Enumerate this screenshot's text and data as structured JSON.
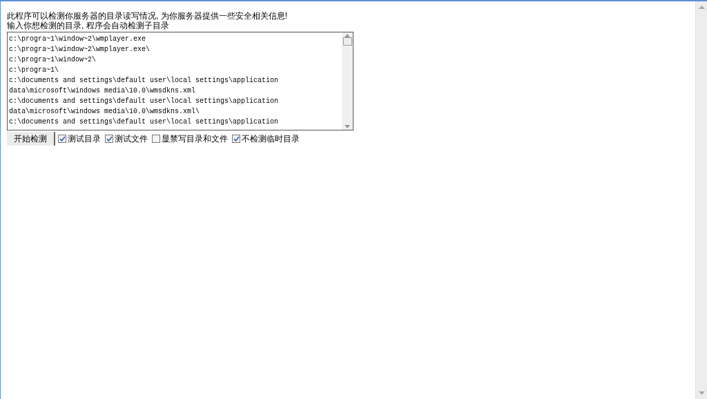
{
  "intro": [
    "此程序可以检测你服务器的目录读写情况, 为你服务器提供一些安全相关信息!",
    "输入你想检测的目录, 程序会自动检测子目录"
  ],
  "paths": [
    "c:\\progra~1\\window~2\\wmplayer.exe",
    "c:\\progra~1\\window~2\\wmplayer.exe\\",
    "c:\\progra~1\\window~2\\",
    "c:\\progra~1\\",
    "c:\\documents and settings\\default user\\local settings\\application",
    "data\\microsoft\\windows media\\10.0\\wmsdkns.xml",
    "c:\\documents and settings\\default user\\local settings\\application",
    "data\\microsoft\\windows media\\10.0\\wmsdkns.xml\\",
    "c:\\documents and settings\\default user\\local settings\\application"
  ],
  "start_button": "开始检测",
  "options": [
    {
      "label": "测试目录",
      "checked": true
    },
    {
      "label": "测试文件",
      "checked": true
    },
    {
      "label": "显禁写目录和文件",
      "checked": false
    },
    {
      "label": "不检测临时目录",
      "checked": true
    }
  ]
}
